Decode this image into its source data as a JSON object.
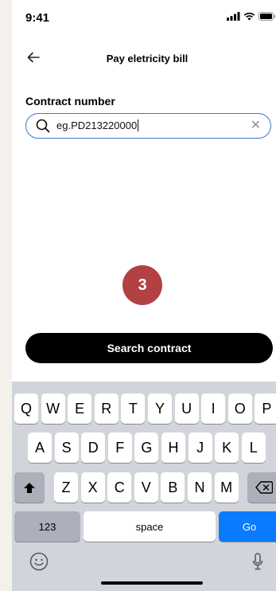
{
  "status_bar": {
    "time": "9:41"
  },
  "nav": {
    "title": "Pay eletricity bill",
    "back_icon": "arrow-left-icon"
  },
  "form": {
    "label": "Contract number",
    "search_value": "eg.PD213220000",
    "search_icon": "search-icon",
    "clear_icon": "clear-icon"
  },
  "step_badge": {
    "number": "3",
    "color": "#b34042"
  },
  "actions": {
    "primary_label": "Search contract"
  },
  "keyboard": {
    "row1": [
      "Q",
      "W",
      "E",
      "R",
      "T",
      "Y",
      "U",
      "I",
      "O",
      "P"
    ],
    "row2": [
      "A",
      "S",
      "D",
      "F",
      "G",
      "H",
      "J",
      "K",
      "L"
    ],
    "row3": [
      "Z",
      "X",
      "C",
      "V",
      "B",
      "N",
      "M"
    ],
    "numbers_key": "123",
    "space_key": "space",
    "go_key": "Go",
    "accent_color": "#0a7bff"
  }
}
